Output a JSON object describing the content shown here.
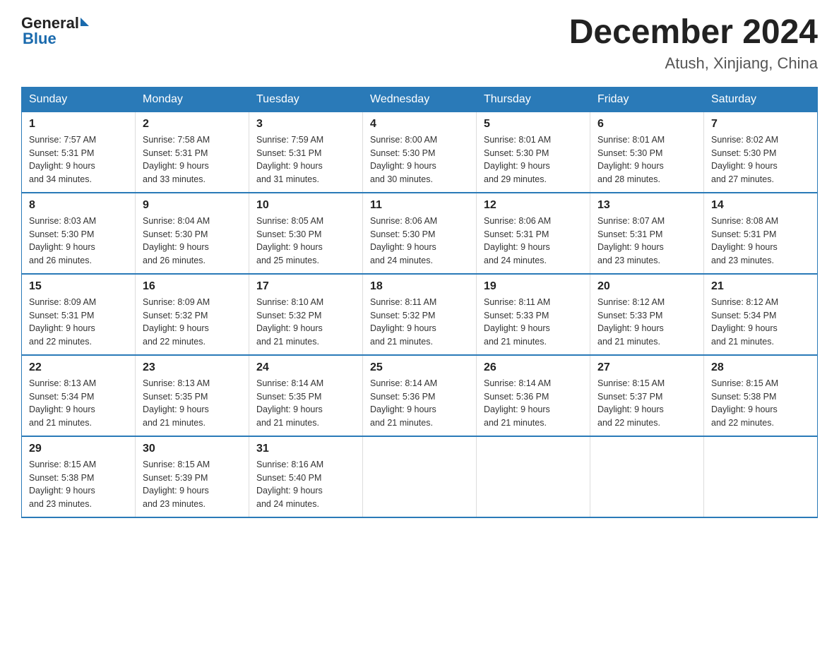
{
  "header": {
    "logo_general": "General",
    "logo_blue": "Blue",
    "month_title": "December 2024",
    "location": "Atush, Xinjiang, China"
  },
  "days_of_week": [
    "Sunday",
    "Monday",
    "Tuesday",
    "Wednesday",
    "Thursday",
    "Friday",
    "Saturday"
  ],
  "weeks": [
    [
      {
        "day": "1",
        "sunrise": "7:57 AM",
        "sunset": "5:31 PM",
        "daylight": "9 hours and 34 minutes."
      },
      {
        "day": "2",
        "sunrise": "7:58 AM",
        "sunset": "5:31 PM",
        "daylight": "9 hours and 33 minutes."
      },
      {
        "day": "3",
        "sunrise": "7:59 AM",
        "sunset": "5:31 PM",
        "daylight": "9 hours and 31 minutes."
      },
      {
        "day": "4",
        "sunrise": "8:00 AM",
        "sunset": "5:30 PM",
        "daylight": "9 hours and 30 minutes."
      },
      {
        "day": "5",
        "sunrise": "8:01 AM",
        "sunset": "5:30 PM",
        "daylight": "9 hours and 29 minutes."
      },
      {
        "day": "6",
        "sunrise": "8:01 AM",
        "sunset": "5:30 PM",
        "daylight": "9 hours and 28 minutes."
      },
      {
        "day": "7",
        "sunrise": "8:02 AM",
        "sunset": "5:30 PM",
        "daylight": "9 hours and 27 minutes."
      }
    ],
    [
      {
        "day": "8",
        "sunrise": "8:03 AM",
        "sunset": "5:30 PM",
        "daylight": "9 hours and 26 minutes."
      },
      {
        "day": "9",
        "sunrise": "8:04 AM",
        "sunset": "5:30 PM",
        "daylight": "9 hours and 26 minutes."
      },
      {
        "day": "10",
        "sunrise": "8:05 AM",
        "sunset": "5:30 PM",
        "daylight": "9 hours and 25 minutes."
      },
      {
        "day": "11",
        "sunrise": "8:06 AM",
        "sunset": "5:30 PM",
        "daylight": "9 hours and 24 minutes."
      },
      {
        "day": "12",
        "sunrise": "8:06 AM",
        "sunset": "5:31 PM",
        "daylight": "9 hours and 24 minutes."
      },
      {
        "day": "13",
        "sunrise": "8:07 AM",
        "sunset": "5:31 PM",
        "daylight": "9 hours and 23 minutes."
      },
      {
        "day": "14",
        "sunrise": "8:08 AM",
        "sunset": "5:31 PM",
        "daylight": "9 hours and 23 minutes."
      }
    ],
    [
      {
        "day": "15",
        "sunrise": "8:09 AM",
        "sunset": "5:31 PM",
        "daylight": "9 hours and 22 minutes."
      },
      {
        "day": "16",
        "sunrise": "8:09 AM",
        "sunset": "5:32 PM",
        "daylight": "9 hours and 22 minutes."
      },
      {
        "day": "17",
        "sunrise": "8:10 AM",
        "sunset": "5:32 PM",
        "daylight": "9 hours and 21 minutes."
      },
      {
        "day": "18",
        "sunrise": "8:11 AM",
        "sunset": "5:32 PM",
        "daylight": "9 hours and 21 minutes."
      },
      {
        "day": "19",
        "sunrise": "8:11 AM",
        "sunset": "5:33 PM",
        "daylight": "9 hours and 21 minutes."
      },
      {
        "day": "20",
        "sunrise": "8:12 AM",
        "sunset": "5:33 PM",
        "daylight": "9 hours and 21 minutes."
      },
      {
        "day": "21",
        "sunrise": "8:12 AM",
        "sunset": "5:34 PM",
        "daylight": "9 hours and 21 minutes."
      }
    ],
    [
      {
        "day": "22",
        "sunrise": "8:13 AM",
        "sunset": "5:34 PM",
        "daylight": "9 hours and 21 minutes."
      },
      {
        "day": "23",
        "sunrise": "8:13 AM",
        "sunset": "5:35 PM",
        "daylight": "9 hours and 21 minutes."
      },
      {
        "day": "24",
        "sunrise": "8:14 AM",
        "sunset": "5:35 PM",
        "daylight": "9 hours and 21 minutes."
      },
      {
        "day": "25",
        "sunrise": "8:14 AM",
        "sunset": "5:36 PM",
        "daylight": "9 hours and 21 minutes."
      },
      {
        "day": "26",
        "sunrise": "8:14 AM",
        "sunset": "5:36 PM",
        "daylight": "9 hours and 21 minutes."
      },
      {
        "day": "27",
        "sunrise": "8:15 AM",
        "sunset": "5:37 PM",
        "daylight": "9 hours and 22 minutes."
      },
      {
        "day": "28",
        "sunrise": "8:15 AM",
        "sunset": "5:38 PM",
        "daylight": "9 hours and 22 minutes."
      }
    ],
    [
      {
        "day": "29",
        "sunrise": "8:15 AM",
        "sunset": "5:38 PM",
        "daylight": "9 hours and 23 minutes."
      },
      {
        "day": "30",
        "sunrise": "8:15 AM",
        "sunset": "5:39 PM",
        "daylight": "9 hours and 23 minutes."
      },
      {
        "day": "31",
        "sunrise": "8:16 AM",
        "sunset": "5:40 PM",
        "daylight": "9 hours and 24 minutes."
      },
      null,
      null,
      null,
      null
    ]
  ],
  "labels": {
    "sunrise": "Sunrise:",
    "sunset": "Sunset:",
    "daylight": "Daylight:"
  }
}
